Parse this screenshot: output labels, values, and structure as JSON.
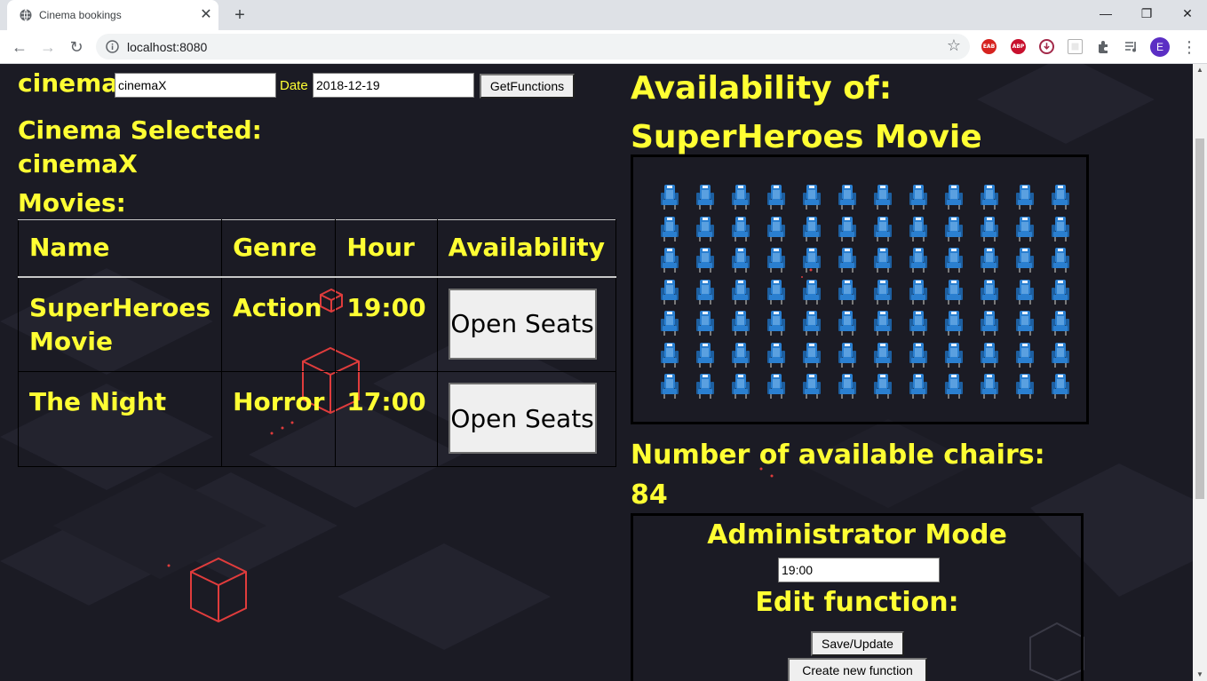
{
  "browser": {
    "tab_title": "Cinema bookings",
    "tab_close": "✕",
    "new_tab": "+",
    "url": "localhost:8080",
    "profile_initial": "E",
    "window_controls": {
      "minimize": "—",
      "restore": "❐",
      "close": "✕"
    },
    "nav": {
      "back": "←",
      "forward": "→",
      "reload": "↻"
    },
    "star": "☆",
    "extensions": [
      "EAB",
      "ABP",
      "download-icon",
      "reader-icon",
      "puzzle-icon",
      "media-icon"
    ]
  },
  "search": {
    "cinema_label": "cinema",
    "cinema_value": "cinemaX",
    "date_label": "Date",
    "date_value": "2018-12-19",
    "get_button": "GetFunctions"
  },
  "selected": {
    "label": "Cinema Selected:",
    "cinema": "cinemaX"
  },
  "movies": {
    "label": "Movies:",
    "headers": [
      "Name",
      "Genre",
      "Hour",
      "Availability"
    ],
    "rows": [
      {
        "name": "SuperHeroes Movie",
        "genre": "Action",
        "hour": "19:00",
        "button": "Open Seats"
      },
      {
        "name": "The Night",
        "genre": "Horror",
        "hour": "17:00",
        "button": "Open Seats"
      }
    ]
  },
  "availability": {
    "title_line1": "Availability of:",
    "title_line2": "SuperHeroes Movie",
    "seat_rows": 7,
    "seat_cols": 12,
    "seat_color": "#2a7fd0",
    "count_label": "Number of available chairs:",
    "count_value": "84"
  },
  "admin": {
    "title": "Administrator Mode",
    "hour_value": "19:00",
    "edit_label": "Edit function:",
    "save_button": "Save/Update",
    "create_button": "Create new function"
  },
  "colors": {
    "text_accent": "#ffff33",
    "background": "#1b1b24",
    "cube_red": "#e03c3c"
  }
}
